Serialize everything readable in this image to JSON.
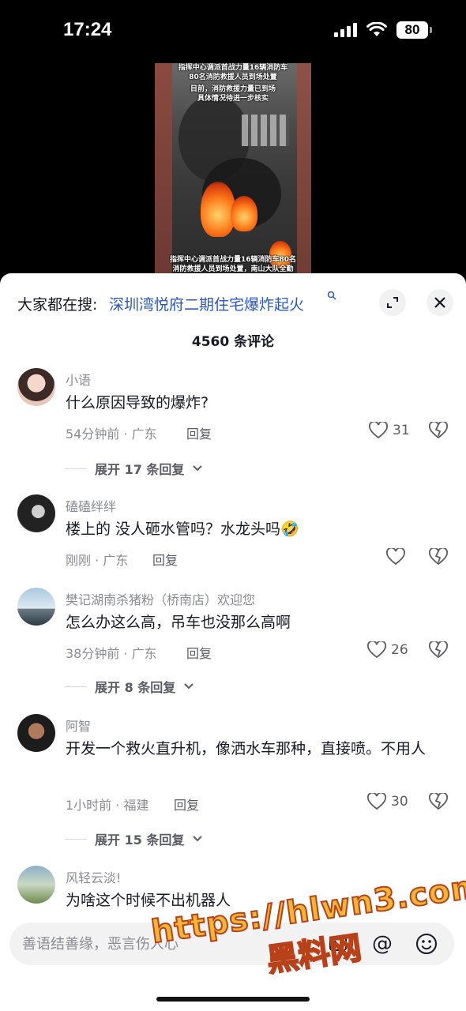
{
  "status_bar": {
    "time": "17:24",
    "battery": "80"
  },
  "video": {
    "caption_top": [
      "指挥中心调派首战力量16辆消防车",
      "80名消防救援人员到场处置",
      "目前，消防救援力量已到场",
      "具体情况待进一步核实"
    ],
    "caption_bottom": [
      "指挥中心调派首战力量16辆消防车80名",
      "消防救援人员到场处置，南山大队全勤"
    ]
  },
  "sheet": {
    "search_prefix": "大家都在搜:",
    "search_term": "深圳湾悦府二期住宅爆炸起火",
    "comment_count": "4560 条评论"
  },
  "comments": [
    {
      "user": "小语",
      "text": "什么原因导致的爆炸?",
      "meta": "54分钟前 · 广东",
      "reply": "回复",
      "likes": "31",
      "expand": "展开 17 条回复"
    },
    {
      "user": "磕磕绊绊",
      "text": "楼上的 没人砸水管吗？水龙头吗🤣",
      "meta": "刚刚 · 广东",
      "reply": "回复",
      "likes": ""
    },
    {
      "user": "樊记湖南杀猪粉（桥南店）欢迎您",
      "text": "怎么办这么高，吊车也没那么高啊",
      "meta": "38分钟前 · 广东",
      "reply": "回复",
      "likes": "26",
      "expand": "展开 8 条回复"
    },
    {
      "user": "阿智",
      "text": "开发一个救火直升机，像洒水车那种，直接喷。不用人",
      "meta": "1小时前 · 福建",
      "reply": "回复",
      "likes": "30",
      "expand": "展开 15 条回复"
    },
    {
      "user": "风轻云淡!",
      "text": "为啥这个时候不出机器人"
    }
  ],
  "input": {
    "placeholder": "善语结善缘，恶言伤人心"
  },
  "watermark": {
    "url": "https://hlwn3.com",
    "name": "黑料网"
  },
  "icons": [
    "signal-icon",
    "wifi-icon",
    "battery-icon",
    "search-icon",
    "expand-icon",
    "close-icon",
    "heart-icon",
    "dislike-icon",
    "chevron-down-icon",
    "at-icon",
    "emoji-icon"
  ],
  "colors": {
    "link": "#2a56c6",
    "text": "#161823",
    "secondary": "#8a8b91",
    "watermark": "#f1b636"
  }
}
